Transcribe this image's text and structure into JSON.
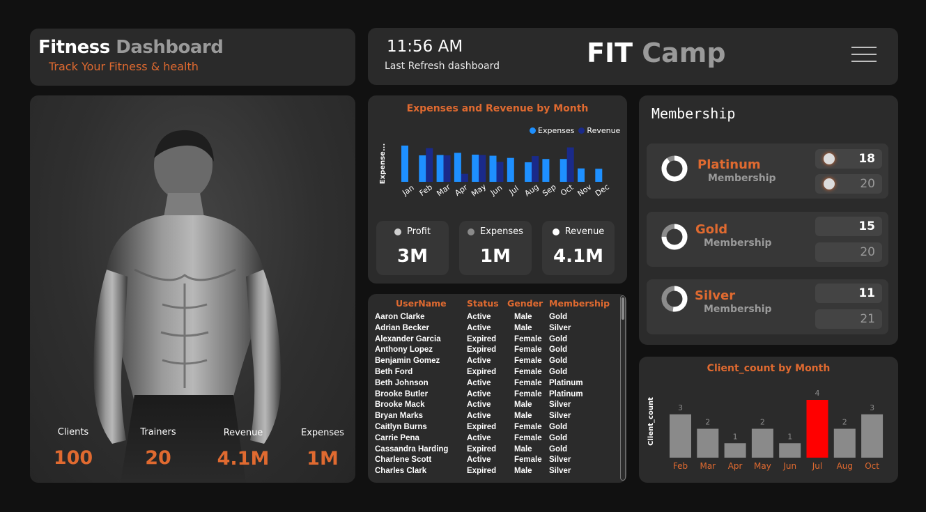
{
  "header_left": {
    "title_white": "Fitness",
    "title_gray": "Dashboard",
    "subtitle": "Track Your Fitness & health"
  },
  "header_right": {
    "time": "11:56 AM",
    "refresh_label": "Last Refresh dashboard",
    "brand_white": "FIT",
    "brand_gray": "Camp"
  },
  "kpis": [
    {
      "label": "Clients",
      "value": "100"
    },
    {
      "label": "Trainers",
      "value": "20"
    },
    {
      "label": "Revenue",
      "value": "4.1M"
    },
    {
      "label": "Expenses",
      "value": "1M"
    }
  ],
  "colors": {
    "accent": "#e06a30",
    "expenses": "#1e90ff",
    "revenue": "#1a2a8a",
    "bar_gray": "#8a8a8a",
    "bar_highlight": "#ff0000"
  },
  "expenses_chart": {
    "title": "Expenses and Revenue by Month",
    "ylabel": "Expense...",
    "legend": [
      "Expenses",
      "Revenue"
    ],
    "stats": [
      {
        "label": "Profit",
        "value": "3M",
        "dot": "#cfcfcf"
      },
      {
        "label": "Expenses",
        "value": "1M",
        "dot": "#8a8a8a"
      },
      {
        "label": "Revenue",
        "value": "4.1M",
        "dot": "#ffffff"
      }
    ]
  },
  "chart_data": [
    {
      "type": "bar",
      "title": "Expenses and Revenue by Month",
      "xlabel": "",
      "ylabel": "Expense...",
      "categories": [
        "Jan",
        "Feb",
        "Mar",
        "Apr",
        "May",
        "Jun",
        "Jul",
        "Aug",
        "Sep",
        "Oct",
        "Nov",
        "Dec"
      ],
      "series": [
        {
          "name": "Expenses",
          "values": [
            100,
            73,
            74,
            80,
            75,
            72,
            66,
            54,
            63,
            63,
            37,
            36
          ]
        },
        {
          "name": "Revenue",
          "values": [
            0,
            93,
            73,
            22,
            74,
            55,
            0,
            71,
            0,
            95,
            0,
            0
          ]
        }
      ],
      "ylim": [
        0,
        100
      ],
      "legend": "top-right",
      "grid": false
    },
    {
      "type": "bar",
      "title": "Client_count by Month",
      "xlabel": "",
      "ylabel": "Client_count",
      "categories": [
        "Feb",
        "Mar",
        "Apr",
        "May",
        "Jun",
        "Jul",
        "Aug",
        "Oct"
      ],
      "values": [
        3,
        2,
        1,
        2,
        1,
        4,
        2,
        3
      ],
      "ylim": [
        0,
        4
      ],
      "highlight": "Jul",
      "grid": false
    }
  ],
  "table": {
    "columns": [
      "UserName",
      "Status",
      "Gender",
      "Membership"
    ],
    "rows": [
      [
        "Aaron Clarke",
        "Active",
        "Male",
        "Gold"
      ],
      [
        "Adrian Becker",
        "Active",
        "Male",
        "Silver"
      ],
      [
        "Alexander Garcia",
        "Expired",
        "Female",
        "Gold"
      ],
      [
        "Anthony Lopez",
        "Expired",
        "Female",
        "Gold"
      ],
      [
        "Benjamin Gomez",
        "Active",
        "Female",
        "Gold"
      ],
      [
        "Beth Ford",
        "Expired",
        "Female",
        "Gold"
      ],
      [
        "Beth Johnson",
        "Active",
        "Female",
        "Platinum"
      ],
      [
        "Brooke Butler",
        "Active",
        "Female",
        "Platinum"
      ],
      [
        "Brooke Mack",
        "Active",
        "Male",
        "Silver"
      ],
      [
        "Bryan Marks",
        "Active",
        "Male",
        "Silver"
      ],
      [
        "Caitlyn Burns",
        "Expired",
        "Female",
        "Gold"
      ],
      [
        "Carrie Pena",
        "Active",
        "Female",
        "Gold"
      ],
      [
        "Cassandra Harding",
        "Expired",
        "Male",
        "Gold"
      ],
      [
        "Charlene Scott",
        "Active",
        "Female",
        "Silver"
      ],
      [
        "Charles Clark",
        "Expired",
        "Male",
        "Silver"
      ]
    ]
  },
  "membership": {
    "title": "Membership",
    "tiers": [
      {
        "name": "Platinum",
        "sub": "Membership",
        "top": "18",
        "bottom": "20",
        "ratio": 0.9
      },
      {
        "name": "Gold",
        "sub": "Membership",
        "top": "15",
        "bottom": "20",
        "ratio": 0.75
      },
      {
        "name": "Silver",
        "sub": "Membership",
        "top": "11",
        "bottom": "21",
        "ratio": 0.52
      }
    ]
  },
  "client_chart": {
    "title": "Client_count by Month",
    "ylabel": "Client_count"
  }
}
